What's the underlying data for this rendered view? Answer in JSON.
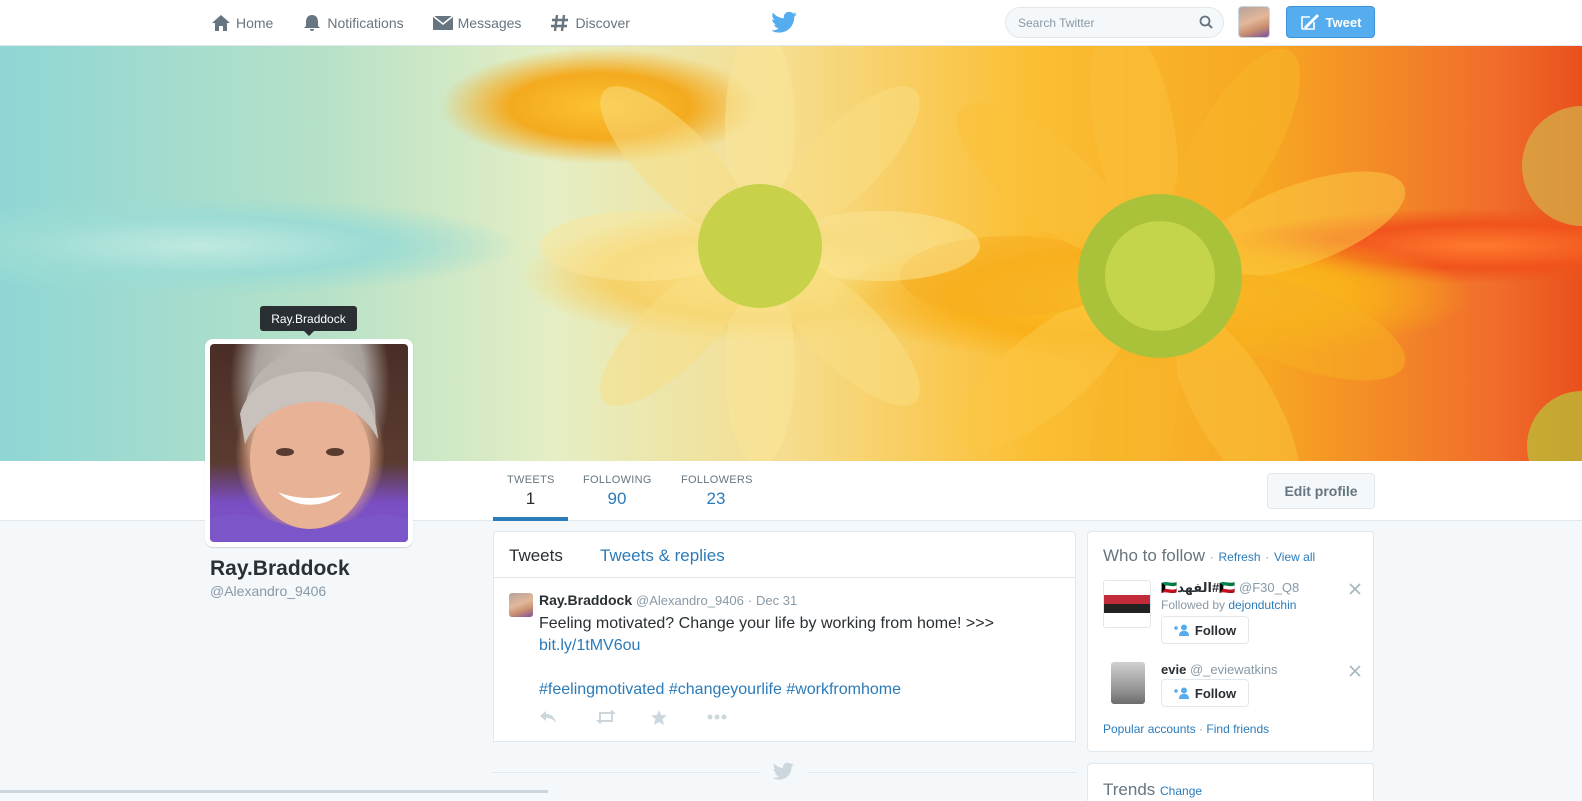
{
  "nav": {
    "home": "Home",
    "notifications": "Notifications",
    "messages": "Messages",
    "discover": "Discover",
    "search_placeholder": "Search Twitter",
    "tweet_button": "Tweet"
  },
  "profile": {
    "tooltip": "Ray.Braddock",
    "name": "Ray.Braddock",
    "handle": "@Alexandro_9406",
    "edit_profile": "Edit profile",
    "stats": [
      {
        "label": "TWEETS",
        "value": "1"
      },
      {
        "label": "FOLLOWING",
        "value": "90"
      },
      {
        "label": "FOLLOWERS",
        "value": "23"
      }
    ]
  },
  "timeline": {
    "tabs": [
      "Tweets",
      "Tweets & replies"
    ],
    "tweet": {
      "name": "Ray.Braddock",
      "handle": "@Alexandro_9406",
      "separator": "·",
      "time": "Dec 31",
      "text": "Feeling motivated? Change your life by working from home! >>>",
      "link": "bit.ly/1tMV6ou",
      "hashtags": [
        "#feelingmotivated",
        "#changeyourlife",
        "#workfromhome"
      ]
    }
  },
  "who_to_follow": {
    "title": "Who to follow",
    "dot": "·",
    "refresh": "Refresh",
    "view_all": "View all",
    "suggestions": [
      {
        "name": "🇰🇼الفهد#🇰🇼",
        "handle": "@F30_Q8",
        "followed_by_label": "Followed by",
        "followed_by": "dejondutchin",
        "button": "Follow"
      },
      {
        "name": "evie",
        "handle": "@_eviewatkins",
        "button": "Follow"
      }
    ],
    "footer": {
      "popular": "Popular accounts",
      "find": "Find friends"
    }
  },
  "trends": {
    "title": "Trends",
    "change": "Change"
  },
  "colors": {
    "accent": "#55acee",
    "link": "#2b7bb9",
    "text": "#292f33",
    "muted": "#8899a6"
  }
}
